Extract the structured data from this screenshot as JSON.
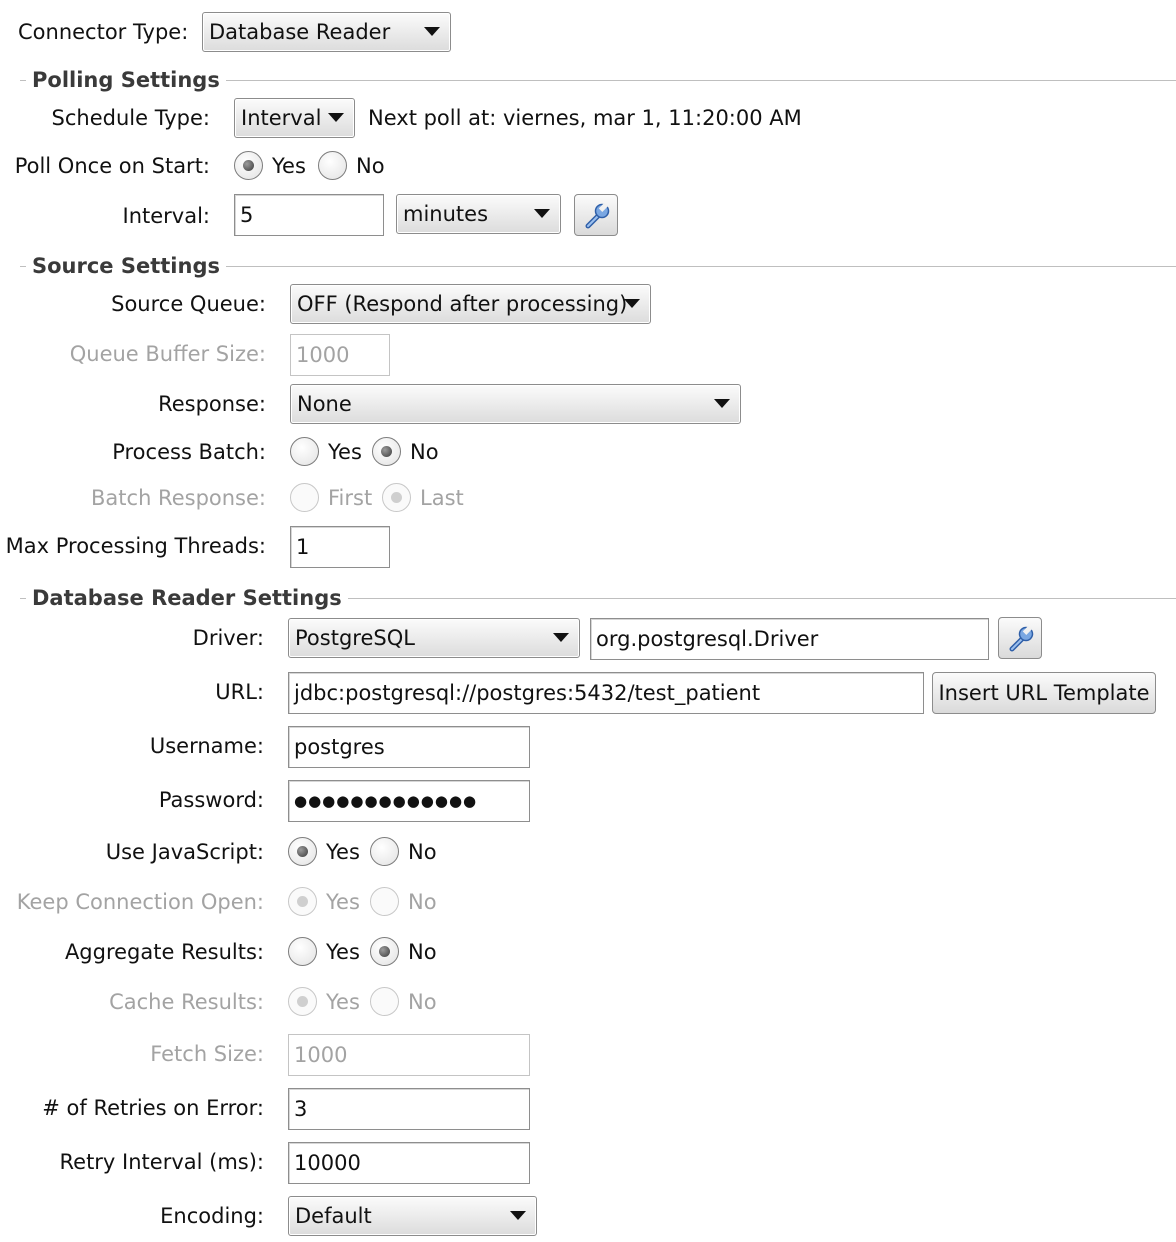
{
  "connector": {
    "label": "Connector Type:",
    "value": "Database Reader"
  },
  "polling": {
    "title": "Polling Settings",
    "schedule_label": "Schedule Type:",
    "schedule_value": "Interval",
    "next_poll": "Next poll at: viernes, mar 1, 11:20:00 AM",
    "poll_once_label": "Poll Once on Start:",
    "poll_once_yes": "Yes",
    "poll_once_no": "No",
    "poll_once_selected": "Yes",
    "interval_label": "Interval:",
    "interval_value": "5",
    "interval_unit": "minutes",
    "icon": "wrench-icon"
  },
  "source": {
    "title": "Source Settings",
    "queue_label": "Source Queue:",
    "queue_value": "OFF (Respond after processing)",
    "buffer_label": "Queue Buffer Size:",
    "buffer_value": "1000",
    "response_label": "Response:",
    "response_value": "None",
    "process_batch_label": "Process Batch:",
    "process_batch_yes": "Yes",
    "process_batch_no": "No",
    "process_batch_selected": "No",
    "batch_response_label": "Batch Response:",
    "batch_response_first": "First",
    "batch_response_last": "Last",
    "batch_response_selected": "Last",
    "threads_label": "Max Processing Threads:",
    "threads_value": "1"
  },
  "db": {
    "title": "Database Reader Settings",
    "driver_label": "Driver:",
    "driver_value": "PostgreSQL",
    "driver_class": "org.postgresql.Driver",
    "url_label": "URL:",
    "url_value": "jdbc:postgresql://postgres:5432/test_patient",
    "insert_url_button": "Insert URL Template",
    "username_label": "Username:",
    "username_value": "postgres",
    "password_label": "Password:",
    "password_mask": "●●●●●●●●●●●●●",
    "use_js_label": "Use JavaScript:",
    "use_js_yes": "Yes",
    "use_js_no": "No",
    "use_js_selected": "Yes",
    "keep_open_label": "Keep Connection Open:",
    "keep_open_yes": "Yes",
    "keep_open_no": "No",
    "keep_open_selected": "Yes",
    "aggregate_label": "Aggregate Results:",
    "aggregate_yes": "Yes",
    "aggregate_no": "No",
    "aggregate_selected": "No",
    "cache_label": "Cache Results:",
    "cache_yes": "Yes",
    "cache_no": "No",
    "cache_selected": "Yes",
    "fetch_label": "Fetch Size:",
    "fetch_value": "1000",
    "retries_label": "# of Retries on Error:",
    "retries_value": "3",
    "retry_interval_label": "Retry Interval (ms):",
    "retry_interval_value": "10000",
    "encoding_label": "Encoding:",
    "encoding_value": "Default"
  }
}
